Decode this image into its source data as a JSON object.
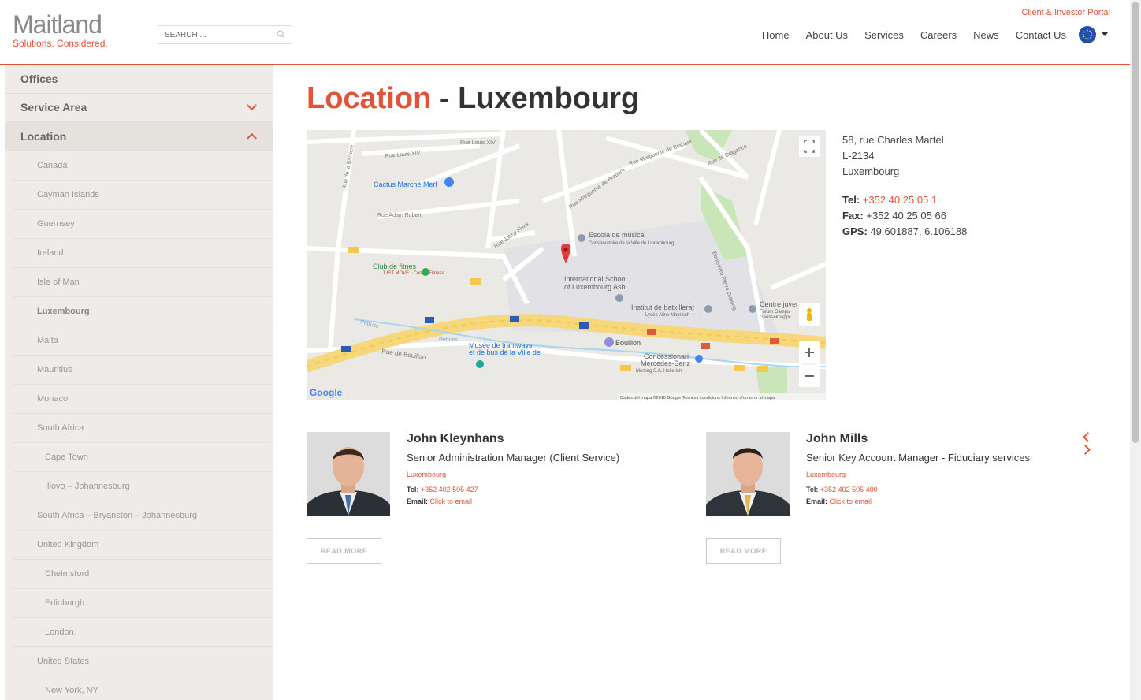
{
  "header": {
    "logo_name": "Maitland",
    "logo_tagline": "Solutions. Considered.",
    "search_placeholder": "SEARCH ...",
    "portal_link": "Client & Investor Portal",
    "nav": [
      "Home",
      "About Us",
      "Services",
      "Careers",
      "News",
      "Contact Us"
    ]
  },
  "sidebar": {
    "top_items": [
      "Offices",
      "Service Area",
      "Location"
    ],
    "locations": [
      {
        "label": "Canada",
        "sub": false
      },
      {
        "label": "Cayman Islands",
        "sub": false
      },
      {
        "label": "Guernsey",
        "sub": false
      },
      {
        "label": "Ireland",
        "sub": false
      },
      {
        "label": "Isle of Man",
        "sub": false
      },
      {
        "label": "Luxembourg",
        "sub": false,
        "active": true
      },
      {
        "label": "Malta",
        "sub": false
      },
      {
        "label": "Mauritius",
        "sub": false
      },
      {
        "label": "Monaco",
        "sub": false
      },
      {
        "label": "South Africa",
        "sub": false
      },
      {
        "label": "Cape Town",
        "sub": true
      },
      {
        "label": "Illovo – Johannesburg",
        "sub": true
      },
      {
        "label": "South Africa – Bryanston – Johannesburg",
        "sub": false
      },
      {
        "label": "United Kingdom",
        "sub": false
      },
      {
        "label": "Chelmsford",
        "sub": true
      },
      {
        "label": "Edinburgh",
        "sub": true
      },
      {
        "label": "London",
        "sub": true
      },
      {
        "label": "United States",
        "sub": false
      },
      {
        "label": "New York, NY",
        "sub": true
      }
    ]
  },
  "main": {
    "title_accent": "Location",
    "title_rest": " - Luxembourg",
    "address": {
      "line1": "58, rue Charles Martel",
      "line2": "L-2134",
      "line3": "Luxembourg",
      "tel_label": "Tel:",
      "tel": "+352 40 25 05 1",
      "fax_label": "Fax:",
      "fax": "+352 40 25 05 66",
      "gps_label": "GPS:",
      "gps": "49.601887, 6.106188"
    },
    "map": {
      "labels": {
        "cactus": "Cactus Marché Merl",
        "escola": "Escola de música",
        "escola_sub": "Conservatoire de la Ville de Luxembourg",
        "club": "Club de fitnes",
        "club_sub": "JUST MOVE - Centre Fitness",
        "school": "International School",
        "school_sub": "of Luxembourg Asbl",
        "institut": "Institut de batxillerat",
        "institut_sub": "Lycée Aline Mayrisch",
        "centre": "Centre juver",
        "centre_sub": "Forum Campu",
        "centre_sub2": "Geesseknäppc",
        "musee": "Musée de tramways",
        "musee_sub": "et de bus de la Ville de",
        "bouillon": "Bouillon",
        "concession": "Concessionari",
        "concession_sub": "Mercedes-Benz",
        "concession_sub2": "Merbag S.A. Hollerich",
        "rue_bouillon": "Rue de Bouillon",
        "petrusse": "Pétruss",
        "footer": "Dades del mapa ©2018 Google   Termes i condicions   Informeu d'un error al mapa",
        "google": "Google"
      }
    },
    "staff": [
      {
        "name": "John Kleynhans",
        "role": "Senior Administration Manager (Client Service)",
        "location": "Luxembourg",
        "tel_label": "Tel:",
        "tel": "+352 402 505 427",
        "email_label": "Email:",
        "email": "Click to email",
        "button": "READ MORE"
      },
      {
        "name": "John Mills",
        "role": "Senior Key Account Manager - Fiduciary services",
        "location": "Luxembourg",
        "tel_label": "Tel:",
        "tel": "+352 402 505 400",
        "email_label": "Email:",
        "email": "Click to email",
        "button": "READ MORE"
      }
    ]
  },
  "colors": {
    "accent": "#e2543a",
    "sidebar_bg": "#eeebe8"
  }
}
